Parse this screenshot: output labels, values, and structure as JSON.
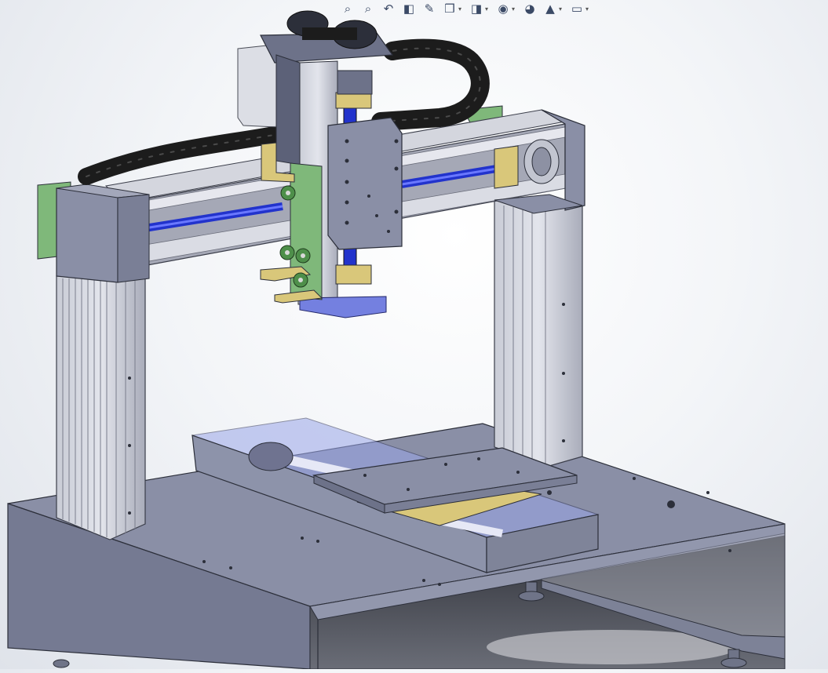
{
  "heads_up_toolbar": [
    {
      "id": "zoom-to-fit-icon",
      "glyph": "⌕",
      "dropdown": false
    },
    {
      "id": "zoom-to-area-icon",
      "glyph": "⌕",
      "dropdown": false
    },
    {
      "id": "previous-view-icon",
      "glyph": "↶",
      "dropdown": false
    },
    {
      "id": "section-view-icon",
      "glyph": "◧",
      "dropdown": false
    },
    {
      "id": "dynamic-annotation-icon",
      "glyph": "✎",
      "dropdown": false
    },
    {
      "id": "view-orientation-icon",
      "glyph": "❒",
      "dropdown": true
    },
    {
      "id": "display-style-icon",
      "glyph": "◨",
      "dropdown": true
    },
    {
      "id": "hide-show-items-icon",
      "glyph": "◉",
      "dropdown": true
    },
    {
      "id": "edit-appearance-icon",
      "glyph": "◕",
      "dropdown": false
    },
    {
      "id": "apply-scene-icon",
      "glyph": "▲",
      "dropdown": true
    },
    {
      "id": "view-settings-icon",
      "glyph": "▭",
      "dropdown": true
    }
  ],
  "colors": {
    "frame_gray": "#8a8fa6",
    "frame_gray_dark": "#5c6178",
    "aluminum": "#c9ccd6",
    "ball_screw_blue": "#2233cc",
    "bracket_yellow": "#d9c77a",
    "plate_green": "#7fb87a",
    "chain_black": "#1c1c1c",
    "transparent_blue": "#9aa6e8"
  }
}
